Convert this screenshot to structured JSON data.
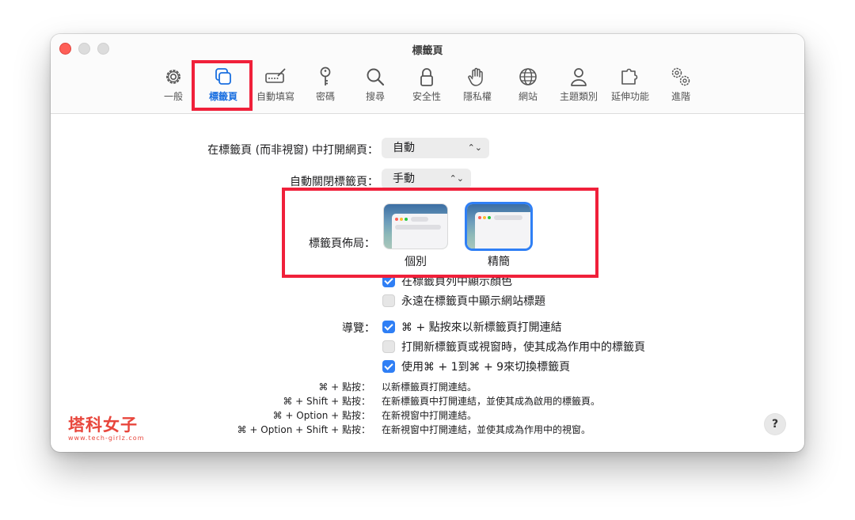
{
  "window": {
    "title": "標籤頁"
  },
  "toolbar": {
    "items": [
      {
        "label": "一般",
        "icon": "gear-icon"
      },
      {
        "label": "標籤頁",
        "icon": "tabs-icon"
      },
      {
        "label": "自動填寫",
        "icon": "autofill-icon"
      },
      {
        "label": "密碼",
        "icon": "key-icon"
      },
      {
        "label": "搜尋",
        "icon": "search-icon"
      },
      {
        "label": "安全性",
        "icon": "lock-icon"
      },
      {
        "label": "隱私權",
        "icon": "hand-icon"
      },
      {
        "label": "網站",
        "icon": "globe-icon"
      },
      {
        "label": "主題類別",
        "icon": "person-icon"
      },
      {
        "label": "延伸功能",
        "icon": "puzzle-icon"
      },
      {
        "label": "進階",
        "icon": "gears-icon"
      }
    ],
    "active": "標籤頁"
  },
  "settings": {
    "open_in_tabs_label": "在標籤頁 (而非視窗) 中打開網頁：",
    "open_in_tabs_value": "自動",
    "auto_close_label": "自動關閉標籤頁：",
    "auto_close_value": "手動",
    "layout_label": "標籤頁佈局：",
    "layout_options": [
      "個別",
      "精簡"
    ],
    "layout_selected": "精簡",
    "show_color_label": "在標籤頁列中顯示顏色",
    "show_color_checked": true,
    "always_show_title_label": "永遠在標籤頁中顯示網站標題",
    "always_show_title_checked": false,
    "nav_label": "導覽：",
    "nav_options": [
      {
        "label": "⌘ + 點按來以新標籤頁打開連結",
        "checked": true
      },
      {
        "label": "打開新標籤頁或視窗時，使其成為作用中的標籤頁",
        "checked": false
      },
      {
        "label": "使用⌘ + 1到⌘ + 9來切換標籤頁",
        "checked": true
      }
    ]
  },
  "shortcuts": [
    {
      "keys": "⌘ + 點按：",
      "desc": "以新標籤頁打開連結。"
    },
    {
      "keys": "⌘ + Shift + 點按：",
      "desc": "在新標籤頁中打開連結，並使其成為啟用的標籤頁。"
    },
    {
      "keys": "⌘ + Option + 點按：",
      "desc": "在新視窗中打開連結。"
    },
    {
      "keys": "⌘ + Option + Shift + 點按：",
      "desc": "在新視窗中打開連結，並使其成為作用中的視窗。"
    }
  ],
  "help_label": "?",
  "watermark": {
    "name": "塔科女子",
    "url": "www.tech-girlz.com"
  },
  "colors": {
    "accent": "#2f7ff5",
    "highlight": "#f0203a"
  }
}
